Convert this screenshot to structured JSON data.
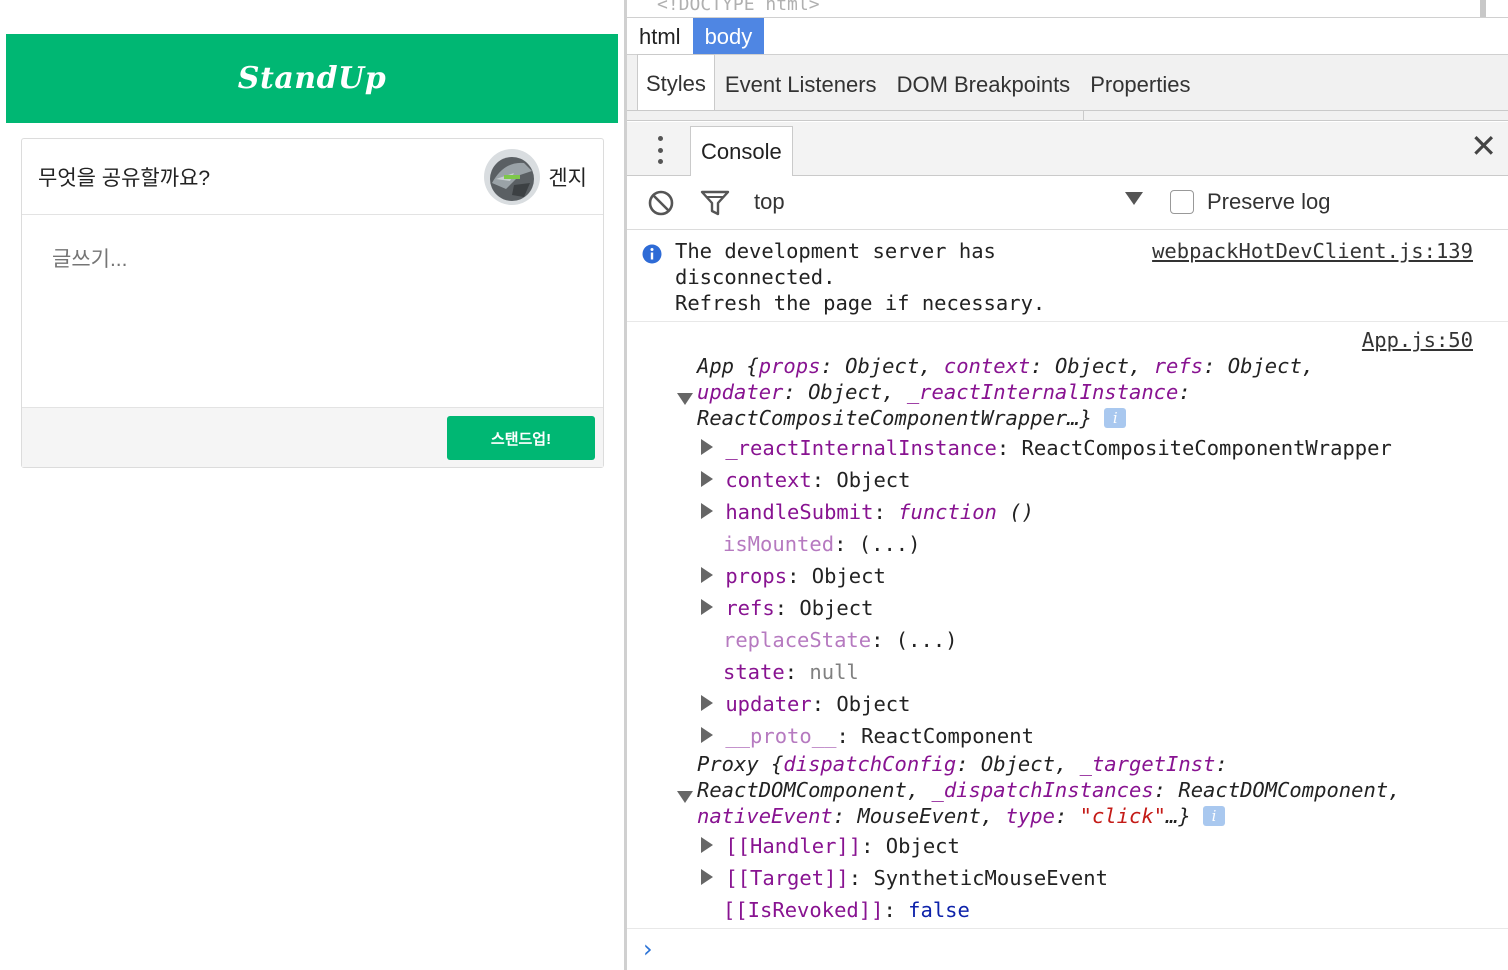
{
  "app": {
    "brand": "StandUp",
    "prompt": "무엇을 공유할까요?",
    "user_name": "겐지",
    "textarea_placeholder": "글쓰기...",
    "submit_label": "스탠드업!",
    "brand_color": "#00b773"
  },
  "devtools": {
    "doctype": "<!DOCTYPE html>",
    "breadcrumbs": [
      "html",
      "body"
    ],
    "style_tabs": [
      "Styles",
      "Event Listeners",
      "DOM Breakpoints",
      "Properties"
    ],
    "drawer_tab": "Console",
    "toolbar": {
      "context": "top",
      "preserve_log": "Preserve log"
    },
    "info_message": {
      "line1": "The development server has",
      "line2": "disconnected.",
      "line3": "Refresh the page if necessary.",
      "source": "webpackHotDevClient.js:139"
    },
    "log_source": "App.js:50"
  }
}
